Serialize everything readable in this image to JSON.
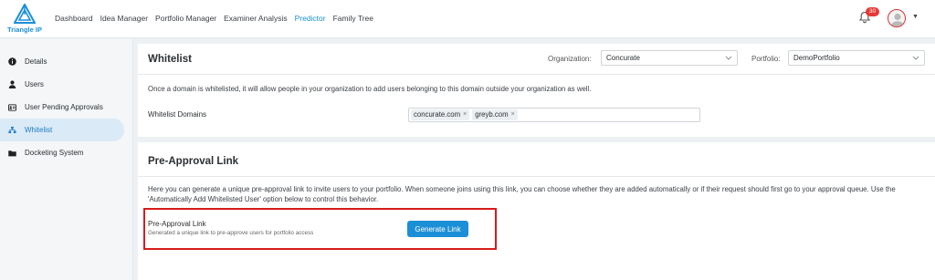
{
  "brand": {
    "logo_text": "Triangle IP"
  },
  "nav": {
    "items": [
      {
        "label": "Dashboard"
      },
      {
        "label": "Idea Manager"
      },
      {
        "label": "Portfolio Manager"
      },
      {
        "label": "Examiner Analysis"
      },
      {
        "label": "Predictor"
      },
      {
        "label": "Family Tree"
      }
    ],
    "notifications_count": "30"
  },
  "sidebar": {
    "items": [
      {
        "label": "Details",
        "icon": "info-icon"
      },
      {
        "label": "Users",
        "icon": "user-icon"
      },
      {
        "label": "User Pending Approvals",
        "icon": "id-card-icon"
      },
      {
        "label": "Whitelist",
        "icon": "network-icon",
        "active": true
      },
      {
        "label": "Docketing System",
        "icon": "folder-icon"
      }
    ]
  },
  "whitelist": {
    "title": "Whitelist",
    "organization_label": "Organization:",
    "organization_value": "Concurate",
    "portfolio_label": "Portfolio:",
    "portfolio_value": "DemoPortfolio",
    "description": "Once a domain is whitelisted, it will allow people in your organization to add users belonging to this domain outside your organization as well.",
    "domains_label": "Whitelist Domains",
    "domains": [
      "concurate.com",
      "greyb.com"
    ],
    "remove_glyph": "×"
  },
  "pre_approval": {
    "title": "Pre-Approval Link",
    "description_line1": "Here you can generate a unique pre-approval link to invite users to your portfolio. When someone joins using this link, you can choose whether they are added automatically or if their request should first go to your approval queue. Use the",
    "description_line2": "'Automatically Add Whitelisted User' option below to control this behavior.",
    "link_label": "Pre-Approval Link",
    "link_sublabel": "Generated a unique link to pre-approve users for portfolio access",
    "button_label": "Generate Link"
  },
  "colors": {
    "accent": "#1b8fd6",
    "highlight": "#d81b1b",
    "badge": "#e53935"
  }
}
